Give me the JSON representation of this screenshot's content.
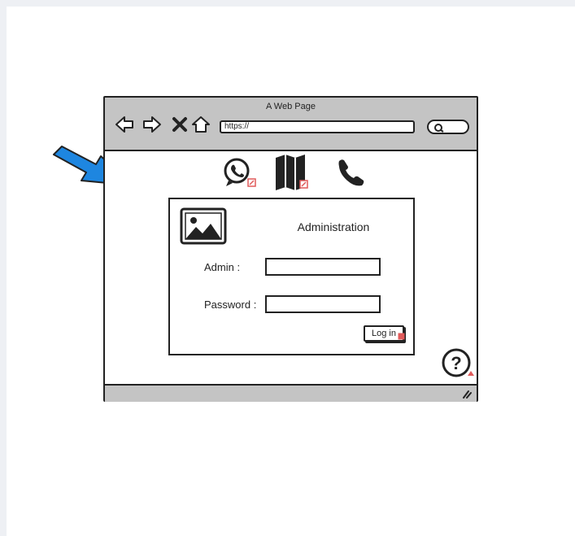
{
  "browser": {
    "title": "A Web Page",
    "url": "https://",
    "nav_icons": [
      "back-arrow-icon",
      "forward-arrow-icon",
      "close-x-icon",
      "home-icon"
    ],
    "search_icon": "search-icon"
  },
  "toolbar_icons": [
    "whatsapp-icon",
    "map-icon",
    "phone-icon"
  ],
  "login_panel": {
    "image_icon": "image-placeholder-icon",
    "heading": "Administration",
    "admin_label": "Admin :",
    "admin_value": "",
    "password_label": "Password :",
    "password_value": "",
    "login_label": "Log in"
  },
  "help_icon": "help-question-icon",
  "annotation_arrow": "pointer-arrow-icon",
  "colors": {
    "chrome": "#c4c4c4",
    "stroke": "#222222",
    "arrow": "#1e86e0",
    "link_marker": "#e05a5a"
  }
}
